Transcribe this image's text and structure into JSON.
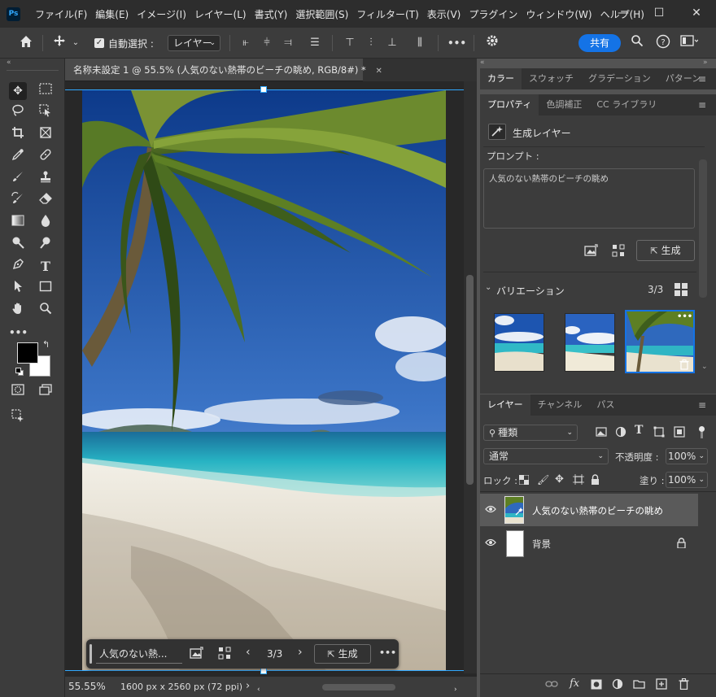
{
  "app": {
    "logo": "Ps",
    "menu": [
      "ファイル(F)",
      "編集(E)",
      "イメージ(I)",
      "レイヤー(L)",
      "書式(Y)",
      "選択範囲(S)",
      "フィルター(T)",
      "表示(V)",
      "プラグイン",
      "ウィンドウ(W)",
      "ヘルプ(H)"
    ],
    "window_controls": {
      "minimize": "—",
      "maximize": "☐",
      "close": "✕"
    }
  },
  "options_bar": {
    "auto_select_label": "自動選択 :",
    "auto_select_target": "レイヤー",
    "more": "•••",
    "share_label": "共有"
  },
  "document": {
    "tab_title": "名称未設定 1 @ 55.5% (人気のない熱帯のビーチの眺め, RGB/8#) *",
    "tab_close": "✕",
    "zoom": "55.55%",
    "dimensions": "1600 px x 2560 px (72 ppi)",
    "status_arrow": "›"
  },
  "contextual_taskbar": {
    "prompt_text": "人気のない熱...",
    "variation_counter": "3/3",
    "generate_label": "生成",
    "more": "•••"
  },
  "color_panel": {
    "tabs": [
      "カラー",
      "スウォッチ",
      "グラデーション",
      "パターン"
    ]
  },
  "properties_panel": {
    "tabs": [
      "プロパティ",
      "色調補正",
      "CC ライブラリ"
    ],
    "layer_type": "生成レイヤー",
    "prompt_label": "プロンプト :",
    "prompt_value": "人気のない熱帯のビーチの眺め",
    "generate_label": "生成",
    "variations_label": "バリエーション",
    "variations_count": "3/3",
    "variation_more": "•••"
  },
  "layers_panel": {
    "tabs": [
      "レイヤー",
      "チャンネル",
      "パス"
    ],
    "filter_kind": "種類",
    "blend_mode": "通常",
    "opacity_label": "不透明度 :",
    "opacity_value": "100%",
    "lock_label": "ロック :",
    "fill_label": "塗り :",
    "fill_value": "100%",
    "layers": [
      {
        "name": "人気のない熱帯のビーチの眺め",
        "selected": true
      },
      {
        "name": "背景",
        "selected": false,
        "locked": true
      }
    ],
    "footer_icons": [
      "link-icon",
      "fx-icon",
      "mask-icon",
      "adjustment-icon",
      "group-icon",
      "new-layer-icon",
      "trash-icon"
    ],
    "fx_label": "fx"
  },
  "colors": {
    "accent": "#1473e6",
    "selection": "#31a8ff",
    "panel_bg": "#3c3c3c",
    "canvas_bg": "#282828"
  }
}
